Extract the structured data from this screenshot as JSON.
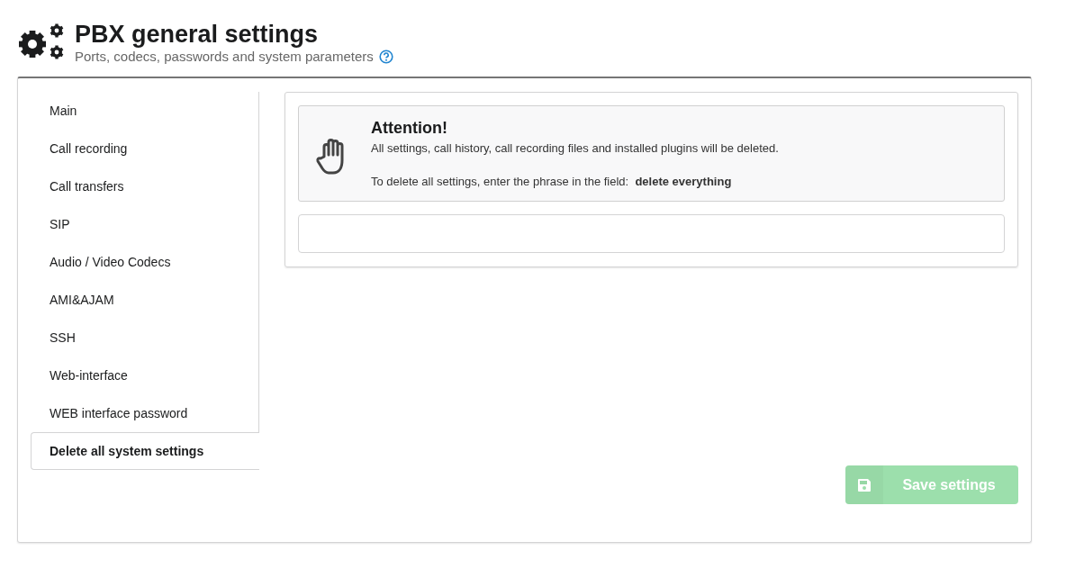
{
  "header": {
    "title": "PBX general settings",
    "subtitle": "Ports, codecs, passwords and system parameters"
  },
  "sidebar": {
    "items": [
      {
        "label": "Main",
        "selected": false
      },
      {
        "label": "Call recording",
        "selected": false
      },
      {
        "label": "Call transfers",
        "selected": false
      },
      {
        "label": "SIP",
        "selected": false
      },
      {
        "label": "Audio / Video Codecs",
        "selected": false
      },
      {
        "label": "AMI&AJAM",
        "selected": false
      },
      {
        "label": "SSH",
        "selected": false
      },
      {
        "label": "Web-interface",
        "selected": false
      },
      {
        "label": "WEB interface password",
        "selected": false
      },
      {
        "label": "Delete all system settings",
        "selected": true
      }
    ]
  },
  "warning": {
    "title": "Attention!",
    "text": "All settings, call history, call recording files and installed plugins will be deleted.",
    "instruction": "To delete all settings, enter the phrase in the field:  **delete everything**"
  },
  "save_button": {
    "label": "Save settings",
    "disabled": true
  }
}
